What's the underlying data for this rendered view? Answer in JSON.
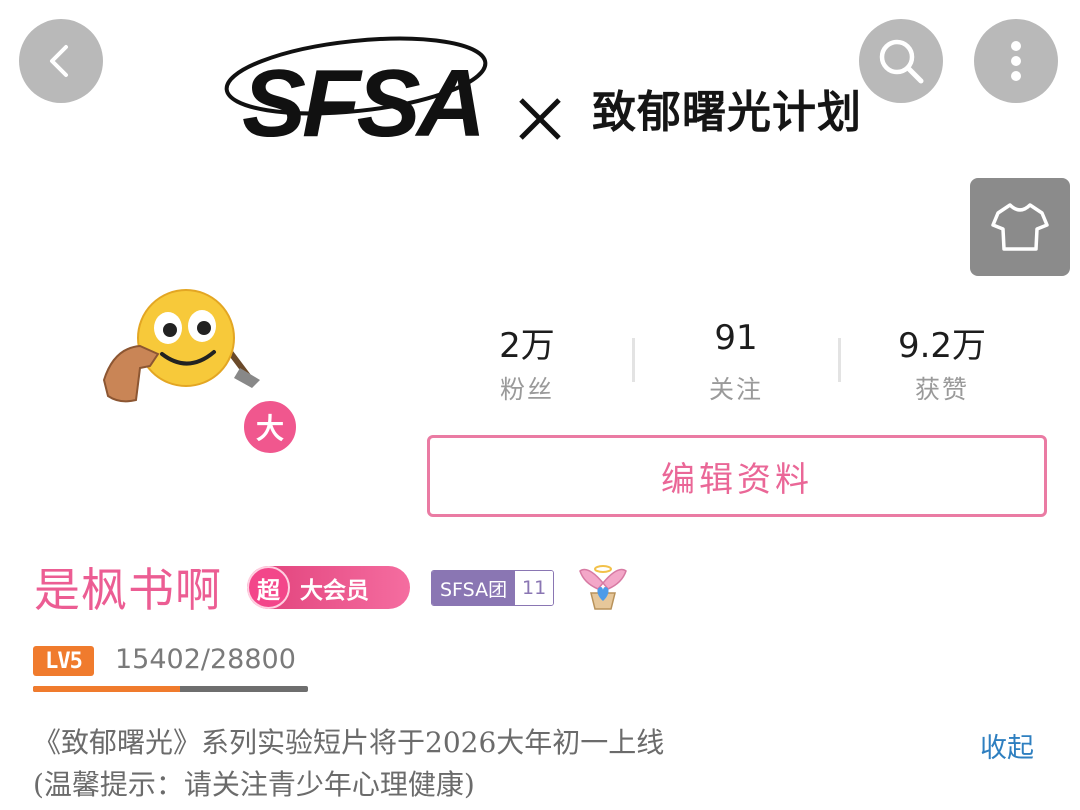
{
  "banner": {
    "logo_text": "SFSA",
    "separator": "×",
    "collab_title": "致郁曙光计划"
  },
  "stats": {
    "fans": {
      "value": "2万",
      "label": "粉丝"
    },
    "following": {
      "value": "91",
      "label": "关注"
    },
    "likes": {
      "value": "9.2万",
      "label": "获赞"
    }
  },
  "edit_profile_label": "编辑资料",
  "avatar_badge": "大",
  "user": {
    "name": "是枫书啊",
    "vip_super": "超",
    "vip_label": "大会员",
    "fan_medal_name": "SFSA团",
    "fan_medal_level": "11",
    "level_badge": "LV5",
    "exp_text": "15402/28800",
    "exp_progress": 0.535
  },
  "bio": {
    "line1": "《致郁曙光》系列实验短片将于2026大年初一上线",
    "line2": "(温馨提示：请关注青少年心理健康)",
    "collapse_label": "收起"
  },
  "icons": {
    "back": "chevron-left-icon",
    "search": "search-icon",
    "more": "more-vertical-icon",
    "outfit": "tshirt-icon",
    "angel": "angel-heart-icon"
  },
  "colors": {
    "accent_pink": "#ec5d93",
    "level_orange": "#f07b2d",
    "link_blue": "#2e7fc0",
    "medal_purple": "#8a76b3"
  }
}
